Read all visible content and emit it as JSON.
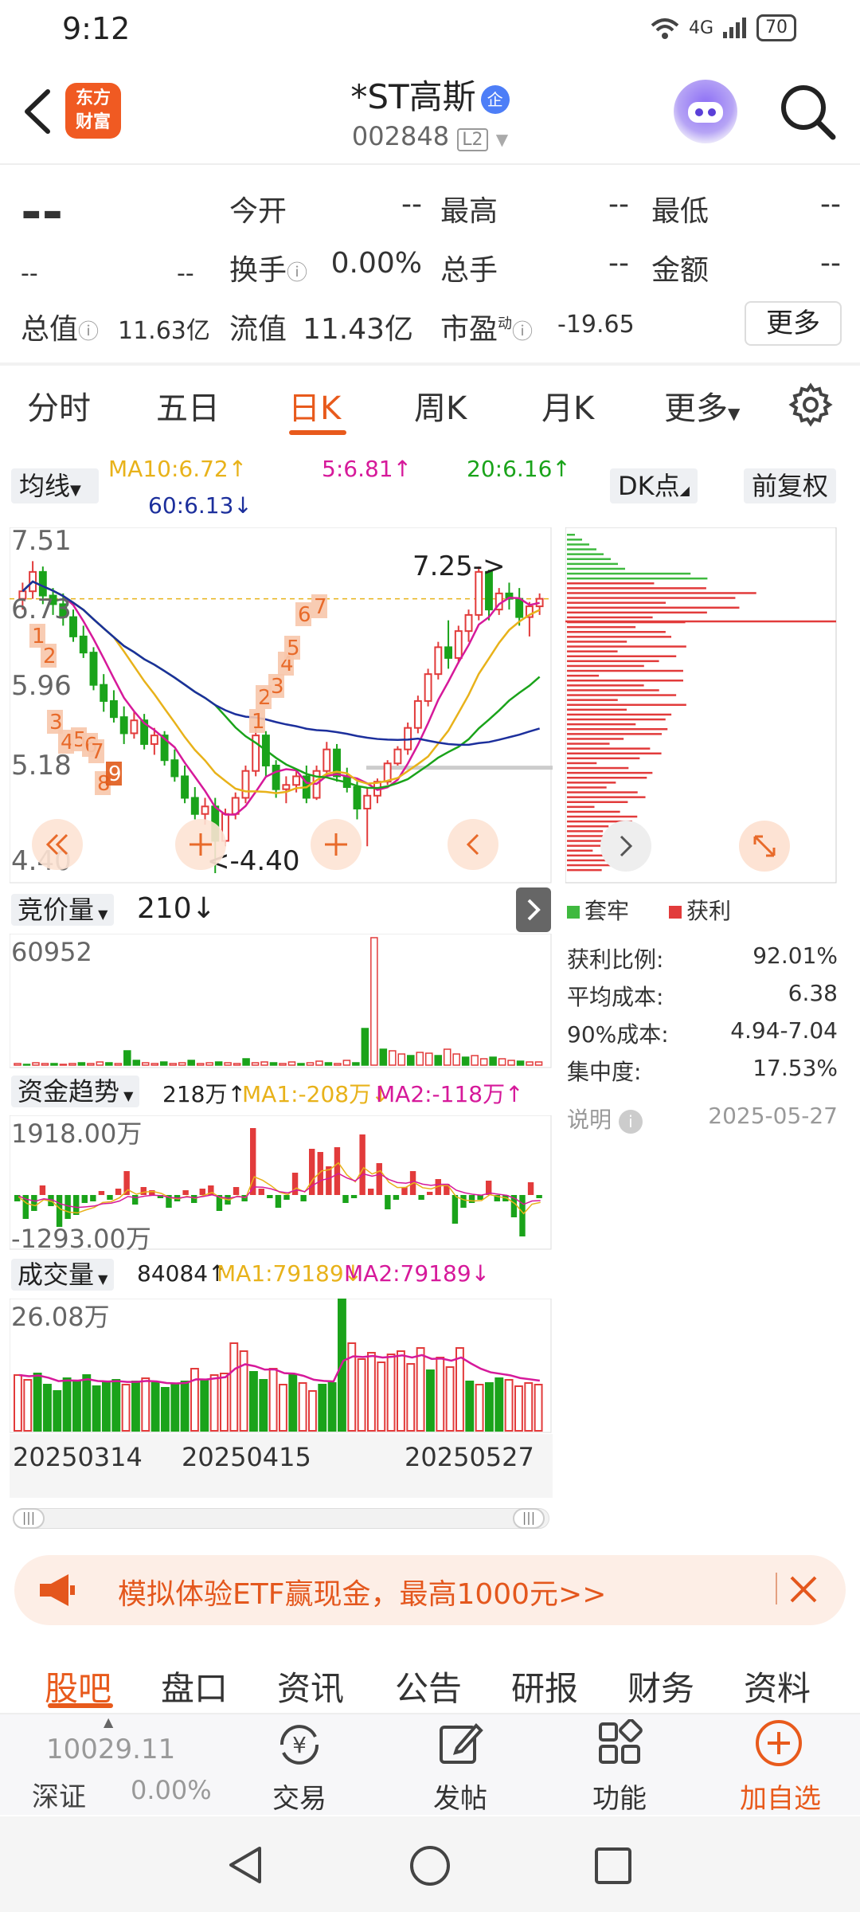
{
  "status": {
    "time": "9:12",
    "network": "4G",
    "battery": "70"
  },
  "header": {
    "logo": [
      "东方",
      "财富"
    ],
    "name": "*ST高斯",
    "badge": "企",
    "code": "002848",
    "level": "L2"
  },
  "quote": {
    "price": "--",
    "change": "--",
    "change_pct": "--",
    "open_label": "今开",
    "open": "--",
    "high_label": "最高",
    "high": "--",
    "low_label": "最低",
    "low": "--",
    "turnover_label": "换手",
    "turnover": "0.00%",
    "volume_label": "总手",
    "volume": "--",
    "amount_label": "金额",
    "amount": "--",
    "mktcap_label": "总值",
    "mktcap": "11.63亿",
    "float_label": "流值",
    "float": "11.43亿",
    "pe_label": "市盈",
    "pe_sup": "动",
    "pe": "-19.65",
    "more": "更多"
  },
  "tabs": [
    "分时",
    "五日",
    "日K",
    "周K",
    "月K",
    "更多"
  ],
  "active_tab": "日K",
  "indicators": {
    "select": "均线",
    "ma10": "MA10:6.72↑",
    "ma5": "5:6.81↑",
    "ma20": "20:6.16↑",
    "ma60": "60:6.13↓",
    "dk_btn": "DK点",
    "adjust_btn": "前复权"
  },
  "kchart": {
    "y_labels": [
      "7.51",
      "6.73",
      "5.96",
      "5.18",
      "4.40"
    ],
    "high_marker": "7.25->",
    "low_marker": "<-4.40",
    "up_color": "#e23b3b",
    "down_color": "#1aa31a",
    "ma5_color": "#d6199a",
    "ma10_color": "#e8b21a",
    "ma20_color": "#1aa31a",
    "ma60_color": "#1c2f9c",
    "td_sequence_labels": [
      "1",
      "2",
      "3",
      "4",
      "5",
      "6",
      "7",
      "8",
      "9",
      "1",
      "2",
      "3",
      "4",
      "5",
      "6",
      "7"
    ]
  },
  "auction": {
    "select": "竞价量",
    "value": "210↓",
    "max_label": "60952"
  },
  "capital": {
    "select": "资金趋势",
    "value": "218万↑",
    "ma1": "MA1:-208万↓",
    "ma2": "MA2:-118万↑",
    "top_label": "1918.00万",
    "bottom_label": "-1293.00万"
  },
  "volume": {
    "select": "成交量",
    "value": "84084↑",
    "ma1": "MA1:79189↓",
    "ma2": "MA2:79189↓",
    "top_label": "26.08万"
  },
  "dates": [
    "20250314",
    "20250415",
    "20250527"
  ],
  "chip": {
    "legend_trapped": "套牢",
    "legend_profit": "获利",
    "rows": [
      {
        "label": "获利比例:",
        "value": "92.01%"
      },
      {
        "label": "平均成本:",
        "value": "6.38"
      },
      {
        "label": "90%成本:",
        "value": "4.94-7.04"
      },
      {
        "label": "集中度:",
        "value": "17.53%"
      }
    ],
    "note_label": "说明",
    "note_date": "2025-05-27"
  },
  "promo": {
    "text": "模拟体验ETF赢现金，最高1000元>>"
  },
  "bottom_tabs": [
    "股吧",
    "盘口",
    "资讯",
    "公告",
    "研报",
    "财务",
    "资料"
  ],
  "bottom_bar": {
    "index_value": "10029.11",
    "index_name": "深证",
    "index_pct": "0.00%",
    "trade": "交易",
    "post": "发帖",
    "func": "功能",
    "add": "加自选"
  },
  "chart_data": {
    "type": "candlestick",
    "title": "*ST高斯 日K",
    "x_range_dates": [
      "20250314",
      "20250415",
      "20250527"
    ],
    "ylim": [
      4.4,
      7.51
    ],
    "y_ticks": [
      7.51,
      6.73,
      5.96,
      5.18,
      4.4
    ],
    "annotated_high": 7.25,
    "annotated_low": 4.4,
    "moving_averages": [
      {
        "name": "MA5",
        "value": 6.81
      },
      {
        "name": "MA10",
        "value": 6.72
      },
      {
        "name": "MA20",
        "value": 6.16
      },
      {
        "name": "MA60",
        "value": 6.13
      }
    ],
    "ohlc": [
      [
        6.95,
        7.1,
        6.85,
        7.02
      ],
      [
        7.02,
        7.3,
        6.95,
        7.2
      ],
      [
        7.2,
        7.25,
        6.9,
        6.98
      ],
      [
        6.98,
        7.05,
        6.8,
        6.9
      ],
      [
        6.9,
        7.0,
        6.7,
        6.78
      ],
      [
        6.78,
        6.85,
        6.55,
        6.6
      ],
      [
        6.6,
        6.7,
        6.4,
        6.45
      ],
      [
        6.45,
        6.5,
        6.1,
        6.15
      ],
      [
        6.15,
        6.25,
        5.9,
        6.0
      ],
      [
        6.0,
        6.1,
        5.8,
        5.85
      ],
      [
        5.85,
        5.95,
        5.6,
        5.7
      ],
      [
        5.7,
        5.9,
        5.65,
        5.82
      ],
      [
        5.82,
        5.88,
        5.55,
        5.6
      ],
      [
        5.6,
        5.75,
        5.5,
        5.68
      ],
      [
        5.68,
        5.72,
        5.4,
        5.45
      ],
      [
        5.45,
        5.55,
        5.25,
        5.3
      ],
      [
        5.3,
        5.4,
        5.05,
        5.1
      ],
      [
        5.1,
        5.2,
        4.9,
        4.95
      ],
      [
        4.95,
        5.1,
        4.85,
        5.02
      ],
      [
        5.02,
        5.1,
        4.4,
        4.7
      ],
      [
        4.7,
        5.0,
        4.65,
        4.95
      ],
      [
        4.95,
        5.15,
        4.9,
        5.1
      ],
      [
        5.1,
        5.4,
        5.05,
        5.35
      ],
      [
        5.35,
        5.75,
        5.3,
        5.68
      ],
      [
        5.68,
        5.72,
        5.3,
        5.4
      ],
      [
        5.4,
        5.45,
        5.1,
        5.18
      ],
      [
        5.18,
        5.3,
        5.05,
        5.22
      ],
      [
        5.22,
        5.35,
        5.15,
        5.3
      ],
      [
        5.3,
        5.4,
        5.05,
        5.1
      ],
      [
        5.1,
        5.4,
        5.08,
        5.35
      ],
      [
        5.35,
        5.62,
        5.3,
        5.55
      ],
      [
        5.55,
        5.6,
        5.25,
        5.3
      ],
      [
        5.3,
        5.38,
        5.15,
        5.2
      ],
      [
        5.2,
        5.25,
        4.9,
        5.0
      ],
      [
        5.0,
        5.2,
        4.65,
        5.12
      ],
      [
        5.12,
        5.28,
        5.05,
        5.25
      ],
      [
        5.25,
        5.45,
        5.22,
        5.42
      ],
      [
        5.42,
        5.58,
        5.4,
        5.55
      ],
      [
        5.55,
        5.8,
        5.5,
        5.75
      ],
      [
        5.75,
        6.05,
        5.7,
        6.0
      ],
      [
        6.0,
        6.3,
        5.95,
        6.25
      ],
      [
        6.25,
        6.55,
        6.2,
        6.5
      ],
      [
        6.5,
        6.75,
        6.3,
        6.4
      ],
      [
        6.4,
        6.7,
        6.35,
        6.65
      ],
      [
        6.65,
        6.85,
        6.55,
        6.8
      ],
      [
        6.8,
        7.25,
        6.75,
        7.2
      ],
      [
        7.2,
        7.22,
        6.75,
        6.85
      ],
      [
        6.85,
        7.05,
        6.8,
        7.0
      ],
      [
        7.0,
        7.1,
        6.85,
        6.95
      ],
      [
        6.95,
        7.05,
        6.7,
        6.78
      ],
      [
        6.78,
        6.92,
        6.6,
        6.88
      ],
      [
        6.88,
        7.0,
        6.8,
        6.95
      ]
    ]
  }
}
